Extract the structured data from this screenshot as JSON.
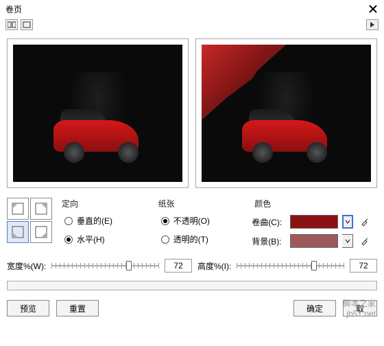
{
  "window": {
    "title": "卷页"
  },
  "settings": {
    "orientation": {
      "label": "定向",
      "vertical": "垂直的(E)",
      "horizontal": "水平(H)",
      "selected": "horizontal"
    },
    "paper": {
      "label": "纸张",
      "opaque": "不透明(O)",
      "transparent": "透明的(T)",
      "selected": "opaque"
    },
    "color": {
      "label": "颜色",
      "curl_label": "卷曲(C):",
      "bg_label": "背景(B):",
      "curl_value": "#8a1212",
      "bg_value": "#9c5a5a"
    }
  },
  "sliders": {
    "width_label": "宽度%(W):",
    "width_value": "72",
    "height_label": "高度%(I):",
    "height_value": "72"
  },
  "buttons": {
    "preview": "预览",
    "reset": "重置",
    "ok": "确定",
    "cancel": "取"
  },
  "watermark": "脚本之家\njb51.net"
}
